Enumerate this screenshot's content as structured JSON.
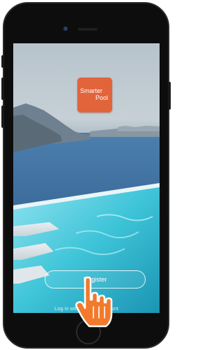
{
  "app": {
    "logo_line1": "Smarter",
    "logo_line2": "Pool",
    "register_label": "Register",
    "login_text": "Log in with existing account"
  },
  "colors": {
    "logo_bg": "#e1643b",
    "phone_body": "#0d0d0e",
    "button_text": "#ffffff"
  },
  "icons": {
    "pointer": "hand-pointer-icon"
  }
}
